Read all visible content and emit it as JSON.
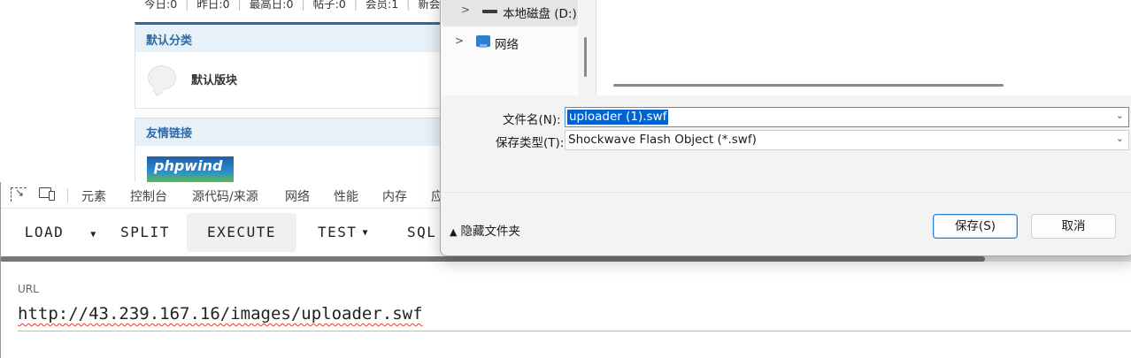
{
  "forum": {
    "stats": [
      "今日:0",
      "昨日:0",
      "最高日:0",
      "帖子:0",
      "会员:1",
      "新会员:a"
    ],
    "category_title": "默认分类",
    "board_name": "默认版块",
    "links_title": "友情链接",
    "logo_text": "phpwind"
  },
  "devtools": {
    "tabs": [
      "元素",
      "控制台",
      "源代码/来源",
      "网络",
      "性能",
      "内存",
      "应"
    ]
  },
  "hackbar": {
    "buttons": [
      "LOAD",
      "SPLIT",
      "EXECUTE",
      "TEST",
      "SQL"
    ],
    "url_label": "URL",
    "url_value": "http://43.239.167.16/images/uploader.swf"
  },
  "dialog": {
    "nav": [
      {
        "label": "本地磁盘 (D:)",
        "icon": "drive-icon",
        "selected": true
      },
      {
        "label": "网络",
        "icon": "network-icon",
        "selected": false
      }
    ],
    "filename_label": "文件名(N):",
    "filename_value": "uploader (1).swf",
    "filetype_label": "保存类型(T):",
    "filetype_value": "Shockwave Flash Object (*.swf)",
    "hide_folders": "隐藏文件夹",
    "save_button": "保存(S)",
    "cancel_button": "取消"
  }
}
